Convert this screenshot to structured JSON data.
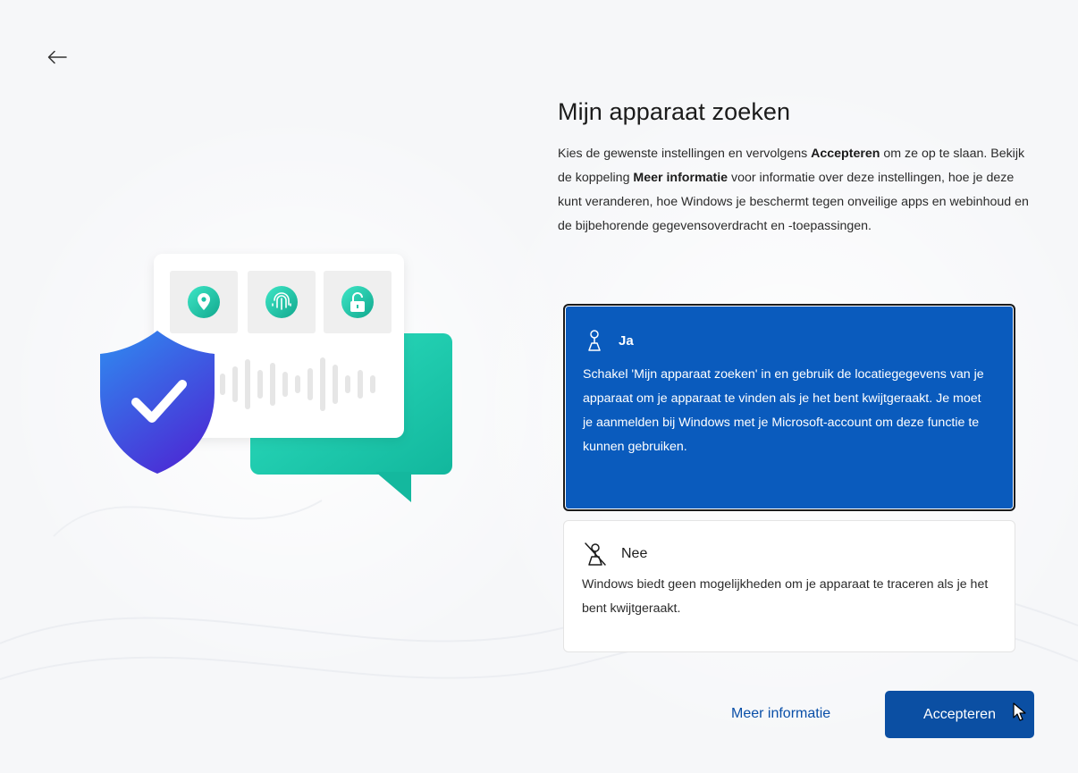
{
  "nav": {
    "back_icon": "arrow-left-icon"
  },
  "header": {
    "title": "Mijn apparaat zoeken"
  },
  "description": {
    "part1": "Kies de gewenste instellingen en vervolgens ",
    "bold1": "Accepteren",
    "part2": " om ze op te slaan. Bekijk de koppeling ",
    "bold2": "Meer informatie",
    "part3": " voor informatie over deze instellingen, hoe je deze kunt veranderen, hoe Windows je beschermt tegen onveilige apps en webinhoud en de bijbehorende gegevensoverdracht en -toepassingen."
  },
  "options": [
    {
      "icon": "location-person-icon",
      "title": "Ja",
      "body": "Schakel 'Mijn apparaat zoeken' in en gebruik de locatiegegevens van je apparaat om je apparaat te vinden als je het bent kwijtgeraakt. Je moet je aanmelden bij Windows met je Microsoft-account om deze functie te kunnen gebruiken.",
      "selected": true
    },
    {
      "icon": "location-person-off-icon",
      "title": "Nee",
      "body": "Windows biedt geen mogelijkheden om je apparaat te traceren als je het bent kwijtgeraakt.",
      "selected": false
    }
  ],
  "footer": {
    "more_info_label": "Meer informatie",
    "accept_label": "Accepteren"
  },
  "illustration": {
    "icons": [
      "location-pin-icon",
      "fingerprint-icon",
      "unlock-icon",
      "shield-check-icon",
      "chat-bubble-icon"
    ]
  },
  "colors": {
    "accent": "#0b4fa3",
    "selected_option": "#0a5bbd",
    "teal": "#1ec9b0",
    "shield": "#2f5fe0"
  }
}
